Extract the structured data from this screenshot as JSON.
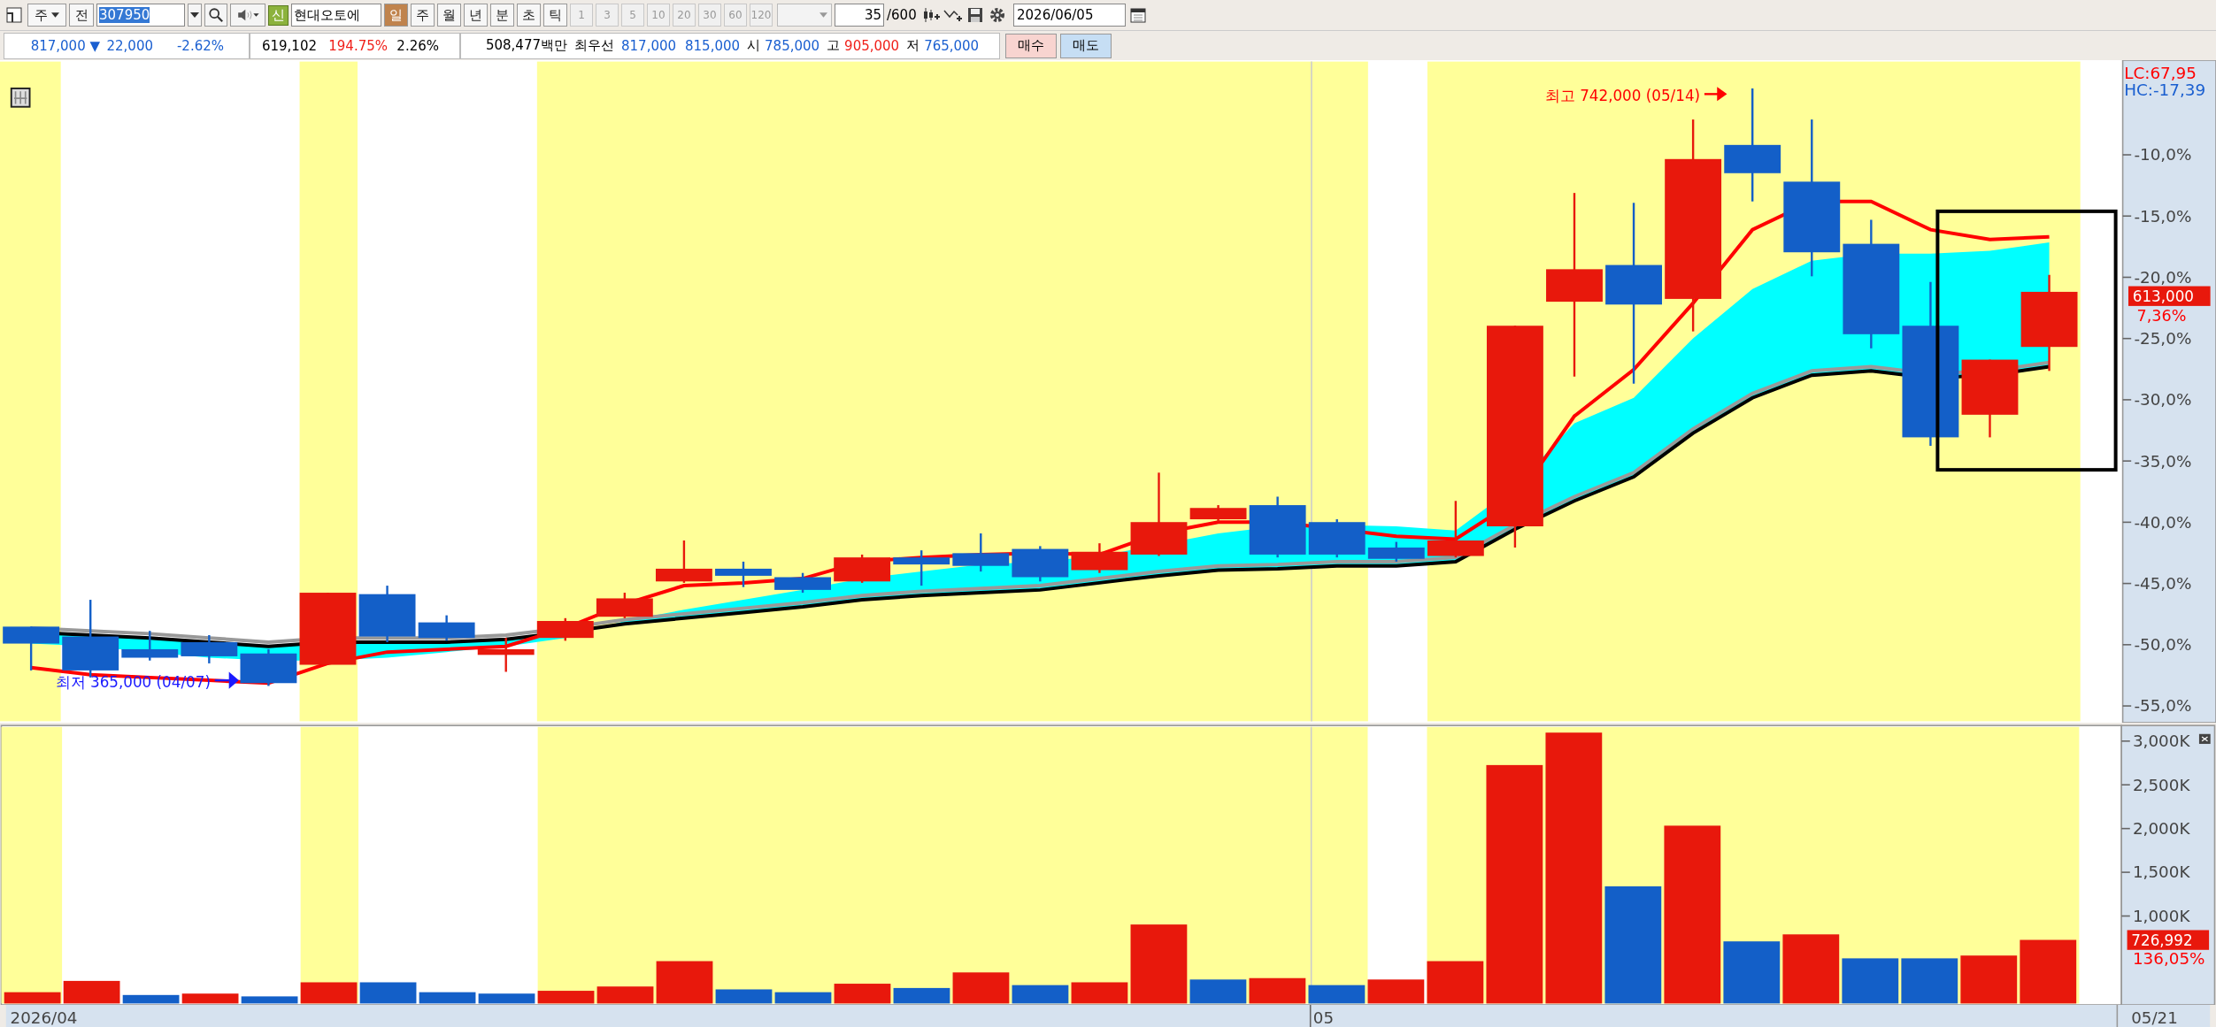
{
  "toolbar": {
    "period_type": "주",
    "all_button": "전",
    "stock_code": "307950",
    "new_badge": "신",
    "stock_name": "현대오토에",
    "periods": [
      {
        "label": "일",
        "selected": true
      },
      {
        "label": "주",
        "selected": false
      },
      {
        "label": "월",
        "selected": false
      },
      {
        "label": "년",
        "selected": false
      },
      {
        "label": "분",
        "selected": false
      },
      {
        "label": "초",
        "selected": false
      },
      {
        "label": "틱",
        "selected": false
      }
    ],
    "intervals": [
      {
        "label": "1",
        "disabled": true
      },
      {
        "label": "3",
        "disabled": true
      },
      {
        "label": "5",
        "disabled": true
      },
      {
        "label": "10",
        "disabled": true
      },
      {
        "label": "20",
        "disabled": true
      },
      {
        "label": "30",
        "disabled": true
      },
      {
        "label": "60",
        "disabled": true
      },
      {
        "label": "120",
        "disabled": true
      }
    ],
    "count": "35",
    "max_count": "/600",
    "date": "2026/06/05"
  },
  "quote": {
    "price": "817,000 ▼",
    "change": "22,000",
    "change_rate": "-2.62%",
    "volume": "619,102",
    "volume_rate": "194.75%",
    "turnover": "2.26%",
    "amount": "508,477백만",
    "best_label": "최우선",
    "best_ask": "817,000",
    "best_bid": "815,000",
    "open_label": "시",
    "open": "785,000",
    "high_label": "고",
    "high": "905,000",
    "low_label": "저",
    "low": "765,000",
    "buy_button": "매수",
    "sell_button": "매도"
  },
  "price_panel": {
    "lc": "LC:67,95",
    "hc": "HC:-17,39",
    "yticks": [
      "-10,0%",
      "-15,0%",
      "-20,0%",
      "-25,0%",
      "-30,0%",
      "-35,0%",
      "-40,0%",
      "-45,0%",
      "-50,0%",
      "-55,0%"
    ],
    "current_price": "613,000",
    "current_rate": "7,36%",
    "high_note": "최고 742,000 (05/14)",
    "low_note": "최저 365,000 (04/07)"
  },
  "volume_panel": {
    "current_volume": "726,992",
    "current_rate": "136,05%",
    "chart_data": {
      "type": "bar",
      "stacked": true,
      "categories": [
        null,
        null,
        null,
        null,
        null,
        null,
        null,
        null,
        null,
        null,
        null,
        null,
        null,
        null,
        null,
        null,
        null,
        null,
        null,
        null,
        null,
        null,
        null,
        null,
        null,
        null,
        null,
        null,
        null,
        null,
        null,
        null,
        null,
        null,
        null
      ],
      "ylim": [
        0,
        3178
      ],
      "yticks": [
        {
          "value": 1000,
          "label": "1,000K"
        },
        {
          "value": 1500,
          "label": "1,500K"
        },
        {
          "value": 2000,
          "label": "2,000K"
        },
        {
          "value": 2500,
          "label": "2,500K"
        },
        {
          "value": 3000,
          "label": "3,000K"
        }
      ],
      "series": [
        {
          "color": "#e8180c",
          "values": [
            129,
            258,
            null,
            113,
            null,
            242,
            null,
            null,
            null,
            145,
            194,
            484,
            null,
            null,
            226,
            null,
            355,
            null,
            242,
            903,
            null,
            290,
            null,
            274,
            484,
            2726,
            3097,
            null,
            2033,
            null,
            790,
            null,
            null,
            548,
            727
          ]
        },
        {
          "color": "#135fc8",
          "values": [
            null,
            null,
            97,
            null,
            81,
            null,
            242,
            129,
            113,
            null,
            null,
            null,
            161,
            129,
            null,
            177,
            null,
            210,
            null,
            null,
            274,
            null,
            210,
            null,
            null,
            null,
            null,
            1339,
            null,
            710,
            null,
            516,
            516,
            null,
            null
          ]
        }
      ]
    }
  },
  "date_axis": {
    "labels": [
      "2026/04",
      "05"
    ],
    "last_date": "05/21"
  }
}
